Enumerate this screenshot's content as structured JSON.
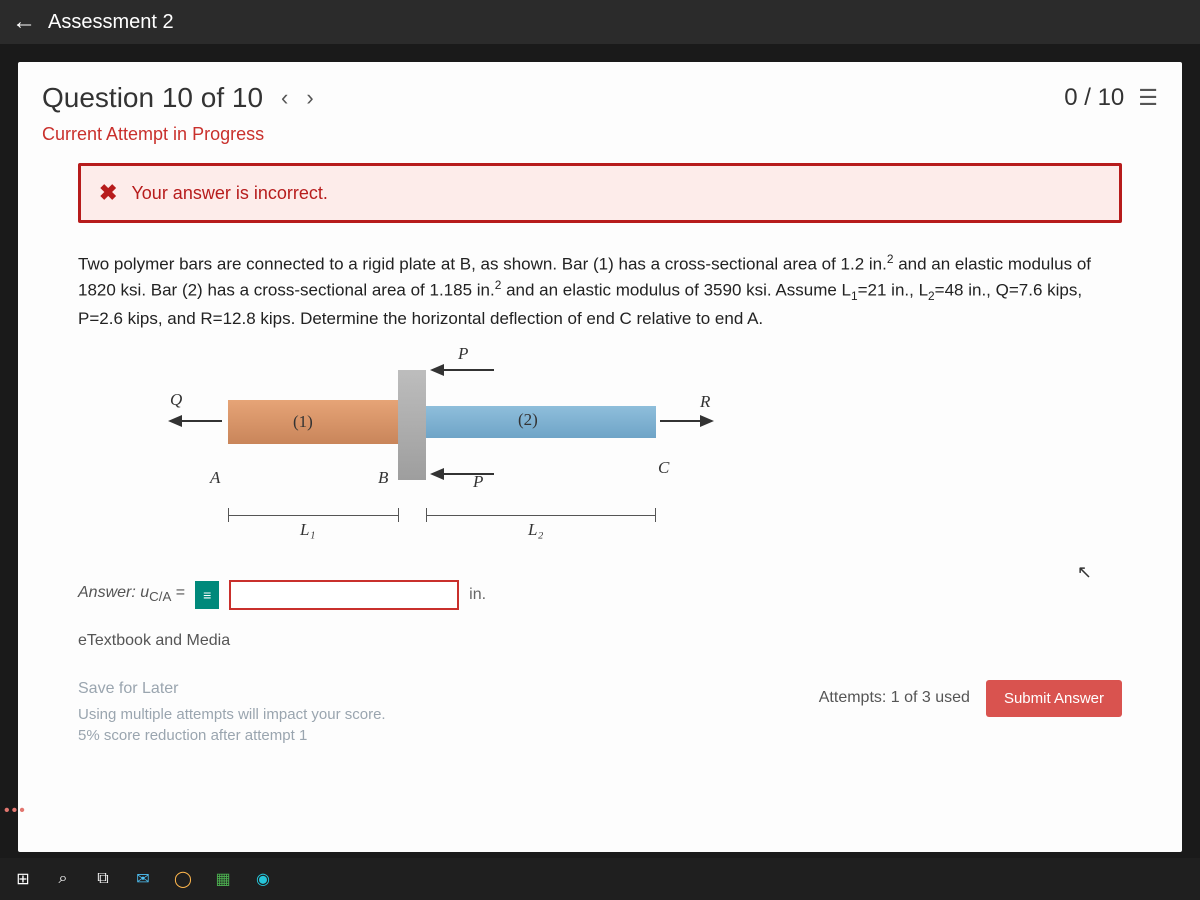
{
  "topbar": {
    "title": "Assessment 2"
  },
  "header": {
    "question_label": "Question 10 of 10",
    "score": "0 / 10"
  },
  "status": "Current Attempt in Progress",
  "error_banner": "Your answer is incorrect.",
  "problem": {
    "p1": "Two polymer bars are connected to a rigid plate at B, as shown. Bar (1) has a cross-sectional area of 1.2 in.",
    "p2": " and an elastic modulus of 1820 ksi. Bar (2) has a cross-sectional area of 1.185 in.",
    "p3": " and an elastic modulus of 3590 ksi. Assume L",
    "p4": "=21 in., L",
    "p5": "=48 in., Q=7.6 kips, P=2.6 kips, and R=12.8 kips. Determine the horizontal deflection of end C relative to end A."
  },
  "diagram": {
    "Q": "Q",
    "P": "P",
    "R": "R",
    "A": "A",
    "B": "B",
    "C": "C",
    "bar1": "(1)",
    "bar2": "(2)",
    "L1": "L₁",
    "L2": "L₂"
  },
  "answer": {
    "label": "Answer: u",
    "sub": "C/A",
    "eq": " = ",
    "unit": "in."
  },
  "etextbook": "eTextbook and Media",
  "footer": {
    "save": "Save for Later",
    "impact1": "Using multiple attempts will impact your score.",
    "impact2": "5% score reduction after attempt 1",
    "attempts": "Attempts: 1 of 3 used",
    "submit": "Submit Answer"
  }
}
